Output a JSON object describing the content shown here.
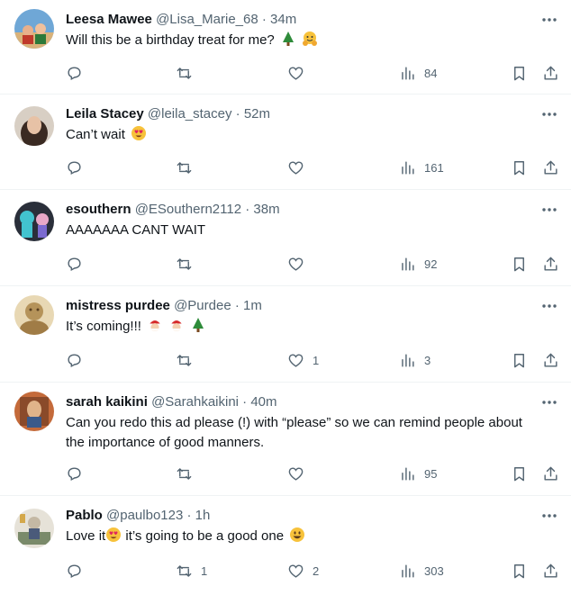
{
  "posts": [
    {
      "name": "Leesa Mawee",
      "handle": "@Lisa_Marie_68",
      "time": "34m",
      "text": "Will this be a birthday treat for me?",
      "emojis": [
        "christmas-tree",
        "hugging-face"
      ],
      "likes": "",
      "views": "84",
      "avatar_color": "#4a7fb5"
    },
    {
      "name": "Leila Stacey",
      "handle": "@leila_stacey",
      "time": "52m",
      "text": "Can’t wait",
      "emojis": [
        "heart-eyes-face"
      ],
      "likes": "",
      "views": "161",
      "avatar_color": "#8a6a55"
    },
    {
      "name": "esouthern",
      "handle": "@ESouthern2112",
      "time": "38m",
      "text": "AAAAAAA CANT WAIT",
      "emojis": [],
      "likes": "",
      "views": "92",
      "avatar_color": "#3aa0a8"
    },
    {
      "name": "mistress purdee",
      "handle": "@Purdee",
      "time": "1m",
      "text": "It’s coming!!!",
      "emojis": [
        "santa-face",
        "santa-face",
        "christmas-tree"
      ],
      "likes": "1",
      "views": "3",
      "avatar_color": "#b89a62"
    },
    {
      "name": "sarah kaikini",
      "handle": "@Sarahkaikini",
      "time": "40m",
      "text": "Can you redo this ad please (!) with “please” so we can remind people about the importance of good manners.",
      "emojis": [],
      "likes": "",
      "views": "95",
      "avatar_color": "#9a5a3a"
    },
    {
      "name": "Pablo",
      "handle": "@paulbo123",
      "time": "1h",
      "text": "Love it",
      "text2": "it’s going to be a good one",
      "emojis": [
        "heart-eyes-face"
      ],
      "emojis2": [
        "grinning-face"
      ],
      "replies": "",
      "retweets": "1",
      "likes": "2",
      "views": "303",
      "avatar_color": "#c8c0b0"
    }
  ],
  "separator": "·",
  "colors": {
    "text": "#0f1419",
    "muted": "#536471",
    "border": "#eff3f4",
    "icon": "#536471"
  }
}
